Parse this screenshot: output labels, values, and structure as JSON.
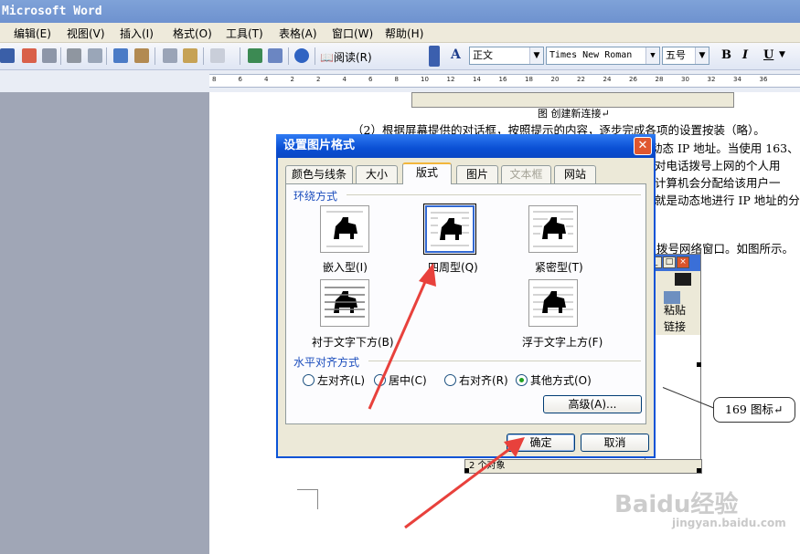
{
  "app": {
    "title": "Microsoft Word"
  },
  "menu": [
    "编辑(E)",
    "视图(V)",
    "插入(I)",
    "格式(O)",
    "工具(T)",
    "表格(A)",
    "窗口(W)",
    "帮助(H)"
  ],
  "toolbar": {
    "read_label": "阅读(R)",
    "style_value": "正文",
    "font_value": "Times New Roman",
    "size_value": "五号",
    "bold": "B",
    "italic": "I",
    "underline": "U",
    "style_icon_label": "A"
  },
  "ruler_ticks": [
    "8",
    "6",
    "4",
    "2",
    "2",
    "4",
    "6",
    "8",
    "10",
    "12",
    "14",
    "16",
    "18",
    "20",
    "22",
    "24",
    "26",
    "28",
    "30",
    "32",
    "34",
    "36"
  ],
  "document": {
    "caption": "图 创建新连接↵",
    "para1": "（2）根据屏幕提供的对话框，按照提示的内容，逐步完成各项的设置按装（略）。",
    "frag1": "动态 IP 地址。当使用 163、",
    "frag2": "对电话拨号上网的个人用",
    "frag3": "计算机会分配给该用户一",
    "frag4": "就是动态地进行 IP 地址的分",
    "frag5": "拨号网络窗口。如图所示。",
    "bg_paste": "粘贴",
    "bg_link": "链接",
    "bg_status": "2 个对象",
    "callout": "169 图标↵"
  },
  "dialog": {
    "title": "设置图片格式",
    "close_glyph": "✕",
    "tabs": [
      {
        "label": "颜色与线条",
        "active": false,
        "disabled": false
      },
      {
        "label": "大小",
        "active": false,
        "disabled": false
      },
      {
        "label": "版式",
        "active": true,
        "disabled": false
      },
      {
        "label": "图片",
        "active": false,
        "disabled": false
      },
      {
        "label": "文本框",
        "active": false,
        "disabled": true
      },
      {
        "label": "网站",
        "active": false,
        "disabled": false
      }
    ],
    "wrap_group_label": "环绕方式",
    "wrap_options": [
      "嵌入型(I)",
      "四周型(Q)",
      "紧密型(T)",
      "衬于文字下方(B)",
      "浮于文字上方(F)"
    ],
    "wrap_selected": "四周型(Q)",
    "align_group_label": "水平对齐方式",
    "align_options": [
      "左对齐(L)",
      "居中(C)",
      "右对齐(R)",
      "其他方式(O)"
    ],
    "align_selected": "其他方式(O)",
    "advanced_button": "高级(A)...",
    "ok_button": "确定",
    "cancel_button": "取消"
  },
  "watermark": {
    "brand": "Baidu经验",
    "url": "jingyan.baidu.com"
  },
  "colors": {
    "titlebar": "#6e92cf",
    "dialog_title": "#0a4fd4",
    "arrow": "#e8413c",
    "accent_tab": "#f2b63b"
  }
}
